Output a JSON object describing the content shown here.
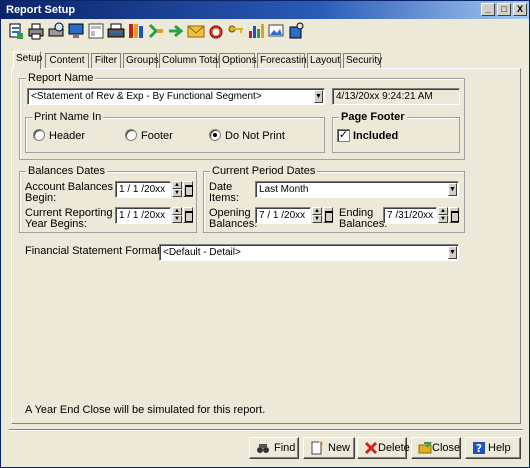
{
  "window": {
    "title": "Report Setup"
  },
  "title_buttons": {
    "minimize": "_",
    "maximize": "□",
    "close": "X"
  },
  "toolbar": {
    "icons": [
      "report-icon",
      "print-icon",
      "print-preview-icon",
      "monitor-icon",
      "layout-icon",
      "printer-icon",
      "books-icon",
      "tree-icon",
      "arrow-tree-icon",
      "email-icon",
      "alarm-icon",
      "key-icon",
      "bar-chart-icon",
      "image-icon",
      "export-icon"
    ]
  },
  "tabs": [
    "Setup",
    "Content",
    "Filter",
    "Groups",
    "Column Totals",
    "Options",
    "Forecasting",
    "Layout",
    "Security"
  ],
  "report_name": {
    "group_label": "Report Name",
    "value": "<Statement of Rev & Exp - By Functional Segment>",
    "timestamp": "4/13/20xx  9:24:21 AM"
  },
  "print_name_in": {
    "group_label": "Print Name In",
    "options": [
      "Header",
      "Footer",
      "Do Not Print"
    ],
    "selected": "Do Not Print"
  },
  "page_footer": {
    "group_label": "Page Footer",
    "checkbox_label": "Included",
    "checked": true,
    "check_mark": "✓"
  },
  "balances_dates": {
    "group_label": "Balances Dates",
    "account_balances_label_1": "Account Balances",
    "account_balances_label_2": "Begin:",
    "account_balances_value": "1 / 1 /20xx",
    "reporting_year_label_1": "Current Reporting",
    "reporting_year_label_2": "Year Begins:",
    "reporting_year_value": "1 / 1 /20xx"
  },
  "current_period": {
    "group_label": "Current Period Dates",
    "date_items_label_1": "Date",
    "date_items_label_2": "Items:",
    "date_items_value": "Last Month",
    "opening_label_1": "Opening",
    "opening_label_2": "Balances:",
    "opening_value": "7 / 1 /20xx",
    "ending_label_1": "Ending",
    "ending_label_2": "Balances:",
    "ending_value": "7 /31/20xx"
  },
  "financial_format": {
    "label": "Financial Statement Format:",
    "value": "<Default - Detail>"
  },
  "notice": "A Year End Close will be simulated for this report.",
  "buttons": {
    "find": "Find",
    "new": "New",
    "delete": "Delete",
    "close": "Close",
    "help": "Help"
  },
  "colors": {
    "title_bar": "#0a246a",
    "dialog_bg": "#ece9d8"
  }
}
